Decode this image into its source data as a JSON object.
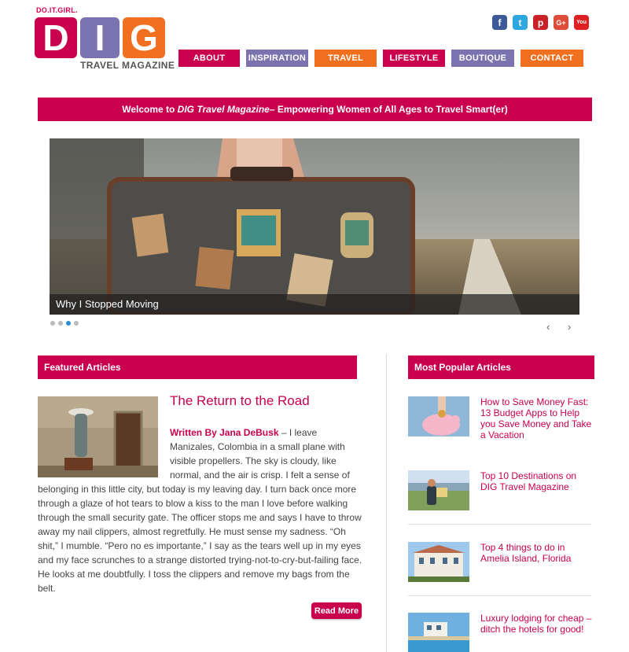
{
  "brand": {
    "tagline": "DO.IT.GIRL.",
    "letters": [
      "D",
      "I",
      "G"
    ],
    "subtitle": "TRAVEL MAGAZINE"
  },
  "social": [
    {
      "name": "facebook-icon",
      "glyph": "f",
      "color": "#3b5998"
    },
    {
      "name": "twitter-icon",
      "glyph": "t",
      "color": "#2ea7de"
    },
    {
      "name": "pinterest-icon",
      "glyph": "p",
      "color": "#cb2027"
    },
    {
      "name": "google-plus-icon",
      "glyph": "G+",
      "color": "#dd4b39"
    },
    {
      "name": "youtube-icon",
      "glyph": "You",
      "color": "#e02020"
    }
  ],
  "nav": [
    {
      "label": "ABOUT",
      "color": "#c8004e"
    },
    {
      "label": "INSPIRATION",
      "color": "#7b73b0"
    },
    {
      "label": "TRAVEL",
      "color": "#f07020"
    },
    {
      "label": "LIFESTYLE",
      "color": "#c8004e"
    },
    {
      "label": "BOUTIQUE",
      "color": "#7b73b0"
    },
    {
      "label": "CONTACT",
      "color": "#f07020"
    }
  ],
  "welcome": {
    "prefix": "Welcome to ",
    "brand": "DIG Travel Magazine",
    "suffix": " – Empowering Women of All Ages to Travel Smart(er)"
  },
  "slider": {
    "caption": "Why I Stopped Moving",
    "slide_count": 4,
    "active_index": 2,
    "prev_glyph": "‹",
    "next_glyph": "›"
  },
  "featured": {
    "heading": "Featured Articles",
    "title": "The Return to the Road",
    "byline": "Written By Jana DeBusk",
    "excerpt": " – I leave Manizales, Colombia in a small plane with visible propellers. The sky is cloudy, like normal, and the air is crisp. I felt a sense of belonging in this little city, but today is my leaving day. I turn back once more through a glaze of hot tears to blow a kiss to the man I love before walking through the small security gate. The officer stops me and says I have to throw away my nail clippers, almost regretfully. He must sense my sadness. “Oh shit,” I mumble. “Pero no es importante,” I say as the tears well up in my eyes and my face scrunches to a strange distorted trying-not-to-cry-but-failing face. He looks at me doubtfully. I toss the clippers and remove my bags from the belt.",
    "read_more": "Read More"
  },
  "popular": {
    "heading": "Most Popular Articles",
    "items": [
      {
        "title": "How to Save Money Fast: 13 Budget Apps to Help you Save Money and Take a Vacation"
      },
      {
        "title": "Top 10 Destinations on DIG Travel Magazine"
      },
      {
        "title": "Top 4 things to do in Amelia Island, Florida"
      },
      {
        "title": "Luxury lodging for cheap – ditch the hotels for good!"
      }
    ]
  },
  "colors": {
    "magenta": "#c8004e",
    "purple": "#7b73b0",
    "orange": "#f07020"
  }
}
